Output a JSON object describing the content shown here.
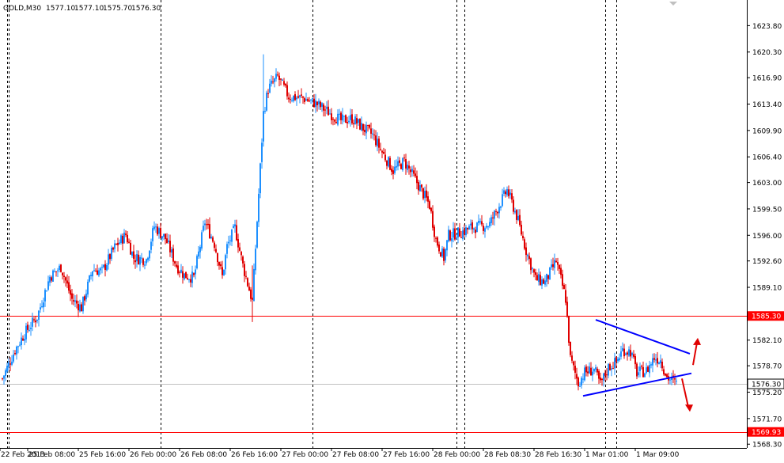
{
  "header": {
    "symbol": "GOLD,M30",
    "open": "1577.10",
    "high": "1577.10",
    "low": "1575.70",
    "close": "1576.30"
  },
  "colors": {
    "background": "#ffffff",
    "bull": "#1e90ff",
    "bear": "#e00000",
    "level_line": "#ff0000",
    "current_line": "#c0c0c0",
    "trendline": "#0000ff",
    "arrow": "#e00000",
    "grid": "#000000"
  },
  "chart_data": {
    "type": "candlestick",
    "instrument": "GOLD",
    "timeframe": "M30",
    "ylim": [
      1567.8,
      1627.2
    ],
    "y_ticks": [
      "1623.80",
      "1620.30",
      "1616.90",
      "1613.40",
      "1609.90",
      "1606.40",
      "1603.00",
      "1599.50",
      "1596.00",
      "1592.60",
      "1589.10",
      "1585.30",
      "1582.10",
      "1578.70",
      "1576.30",
      "1575.20",
      "1571.70",
      "1569.93",
      "1568.30"
    ],
    "x_ticks": [
      "22 Feb 2013",
      "25 Feb 08:00",
      "25 Feb 16:00",
      "26 Feb 00:00",
      "26 Feb 08:00",
      "26 Feb 16:00",
      "27 Feb 00:00",
      "27 Feb 08:00",
      "27 Feb 16:00",
      "28 Feb 00:00",
      "28 Feb 08:30",
      "28 Feb 16:30",
      "1 Mar 01:00",
      "1 Mar 09:00"
    ],
    "day_separators": [
      "25 Feb 00:00",
      "26 Feb 00:00",
      "27 Feb 00:00",
      "28 Feb 00:00",
      "1 Mar 00:00"
    ],
    "grid": "vertical dashed at day boundaries",
    "levels": [
      {
        "label": "1585.30",
        "value": 1585.3,
        "style": "solid red"
      },
      {
        "label": "1569.93",
        "value": 1569.93,
        "style": "solid red"
      },
      {
        "label": "1576.30",
        "value": 1576.3,
        "style": "current price"
      }
    ],
    "pattern": "symmetrical triangle",
    "triangle_upper": [
      [
        1584.8,
        "28 Feb 18:30"
      ],
      [
        1580.3,
        "1 Mar 11:00"
      ]
    ],
    "triangle_lower": [
      [
        1574.7,
        "28 Feb 16:30"
      ],
      [
        1577.7,
        "1 Mar 11:30"
      ]
    ],
    "arrows": [
      {
        "direction": "up",
        "from": 1578.8,
        "to": 1582.4
      },
      {
        "direction": "down",
        "from": 1577.0,
        "to": 1572.6
      }
    ],
    "close_path": [
      [
        0,
        1577.0
      ],
      [
        8,
        1580.8
      ],
      [
        14,
        1583.0
      ],
      [
        22,
        1585.2
      ],
      [
        30,
        1590.5
      ],
      [
        37,
        1591.8
      ],
      [
        44,
        1587.5
      ],
      [
        50,
        1586.4
      ],
      [
        57,
        1591.5
      ],
      [
        63,
        1591.2
      ],
      [
        71,
        1594.4
      ],
      [
        78,
        1596.1
      ],
      [
        83,
        1593.0
      ],
      [
        91,
        1592.8
      ],
      [
        96,
        1597.2
      ],
      [
        103,
        1595.6
      ],
      [
        110,
        1592.0
      ],
      [
        115,
        1590.7
      ],
      [
        121,
        1590.4
      ],
      [
        128,
        1597.8
      ],
      [
        134,
        1594.9
      ],
      [
        139,
        1590.5
      ],
      [
        142,
        1594.5
      ],
      [
        147,
        1597.0
      ],
      [
        152,
        1592.0
      ],
      [
        158,
        1587.2
      ],
      [
        165,
        1612.2
      ],
      [
        168,
        1615.4
      ],
      [
        174,
        1617.0
      ],
      [
        181,
        1614.4
      ],
      [
        190,
        1614.2
      ],
      [
        198,
        1613.5
      ],
      [
        207,
        1612.2
      ],
      [
        214,
        1611.2
      ],
      [
        221,
        1611.5
      ],
      [
        228,
        1610.2
      ],
      [
        234,
        1609.3
      ],
      [
        240,
        1607.0
      ],
      [
        247,
        1604.6
      ],
      [
        254,
        1605.8
      ],
      [
        262,
        1603.0
      ],
      [
        270,
        1600.0
      ],
      [
        274,
        1595.4
      ],
      [
        279,
        1593.0
      ],
      [
        282,
        1596.0
      ],
      [
        290,
        1596.4
      ],
      [
        296,
        1597.0
      ],
      [
        303,
        1597.2
      ],
      [
        308,
        1597.5
      ],
      [
        314,
        1600.0
      ],
      [
        319,
        1602.0
      ],
      [
        325,
        1598.6
      ],
      [
        331,
        1594.0
      ],
      [
        337,
        1590.2
      ],
      [
        343,
        1589.8
      ],
      [
        350,
        1592.6
      ],
      [
        356,
        1587.6
      ],
      [
        359,
        1579.6
      ],
      [
        364,
        1576.4
      ],
      [
        368,
        1577.8
      ],
      [
        374,
        1578.2
      ],
      [
        378,
        1576.2
      ],
      [
        383,
        1578.5
      ],
      [
        388,
        1579.2
      ],
      [
        392,
        1580.8
      ],
      [
        397,
        1580.6
      ],
      [
        401,
        1577.8
      ],
      [
        407,
        1578.0
      ],
      [
        412,
        1579.8
      ],
      [
        416,
        1579.5
      ],
      [
        420,
        1577.2
      ],
      [
        424,
        1576.6
      ],
      [
        426,
        1576.3
      ]
    ]
  }
}
